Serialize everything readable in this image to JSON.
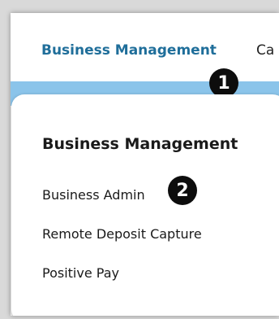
{
  "nav": {
    "active_label": "Business Management",
    "next_label": "Ca"
  },
  "dropdown": {
    "title": "Business Management",
    "items": [
      {
        "label": "Business Admin"
      },
      {
        "label": "Remote Deposit Capture"
      },
      {
        "label": "Positive Pay"
      }
    ]
  },
  "callouts": {
    "one": "1",
    "two": "2"
  },
  "colors": {
    "nav_active": "#1f6e9a",
    "blue_strip": "#8bc4ea",
    "badge": "#0d0d0d"
  }
}
